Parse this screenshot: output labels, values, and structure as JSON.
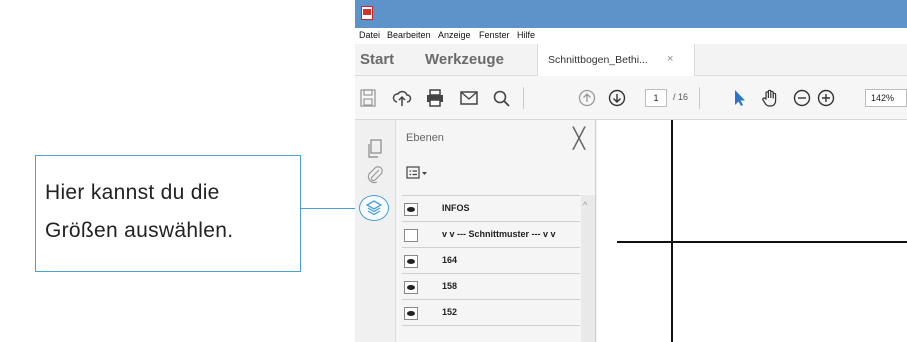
{
  "callout": {
    "line1": "Hier kannst du die",
    "line2": "Größen auswählen.",
    "color": "#4a9fd4"
  },
  "menubar": {
    "items": [
      "Datei",
      "Bearbeiten",
      "Anzeige",
      "Fenster",
      "Hilfe"
    ]
  },
  "tabs": {
    "start": "Start",
    "tools": "Werkzeuge",
    "document": "Schnittbogen_Bethi...",
    "close": "×"
  },
  "toolbar": {
    "page_current": "1",
    "page_total": "/ 16",
    "zoom": "142%",
    "icons": [
      "save-icon",
      "upload-icon",
      "print-icon",
      "mail-icon",
      "search-icon",
      "page-up-icon",
      "page-down-icon",
      "select-arrow-icon",
      "hand-icon",
      "zoom-out-icon",
      "zoom-in-icon"
    ]
  },
  "panel": {
    "title": "Ebenen",
    "close": "╳",
    "layers": [
      {
        "label": "INFOS",
        "visible": true
      },
      {
        "label": "v v --- Schnittmuster --- v v",
        "visible": false
      },
      {
        "label": "164",
        "visible": true
      },
      {
        "label": "158",
        "visible": true
      },
      {
        "label": "152",
        "visible": true
      }
    ]
  },
  "colors": {
    "titlebar": "#5c93c8",
    "accent": "#4a9fd4"
  }
}
